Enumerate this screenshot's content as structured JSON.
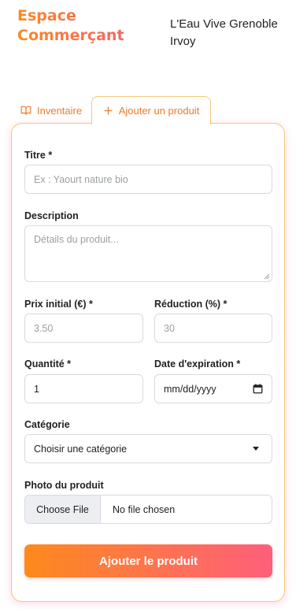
{
  "header": {
    "brand_line1": "Espace",
    "brand_line2": "Commerçant",
    "shop_name": "L'Eau Vive Grenoble Irvoy"
  },
  "tabs": [
    {
      "label": "Inventaire",
      "icon": "book-open-icon",
      "active": false
    },
    {
      "label": "Ajouter un produit",
      "icon": "plus-icon",
      "active": true
    }
  ],
  "form": {
    "title": {
      "label": "Titre *",
      "placeholder": "Ex : Yaourt nature bio",
      "value": ""
    },
    "description": {
      "label": "Description",
      "placeholder": "Détails du produit...",
      "value": ""
    },
    "price": {
      "label": "Prix initial (€) *",
      "placeholder": "3.50",
      "value": ""
    },
    "discount": {
      "label": "Réduction (%) *",
      "placeholder": "30",
      "value": ""
    },
    "quantity": {
      "label": "Quantité *",
      "value": "1"
    },
    "expiry": {
      "label": "Date d'expiration *",
      "value": "mm/dd/yyyy"
    },
    "category": {
      "label": "Catégorie",
      "selected": "Choisir une catégorie"
    },
    "photo": {
      "label": "Photo du produit",
      "button": "Choose File",
      "status": "No file chosen"
    },
    "submit_label": "Ajouter le produit"
  },
  "colors": {
    "accent_orange": "#f98a23",
    "accent_pink": "#fe5f7b",
    "card_border": "#f5c77a"
  }
}
